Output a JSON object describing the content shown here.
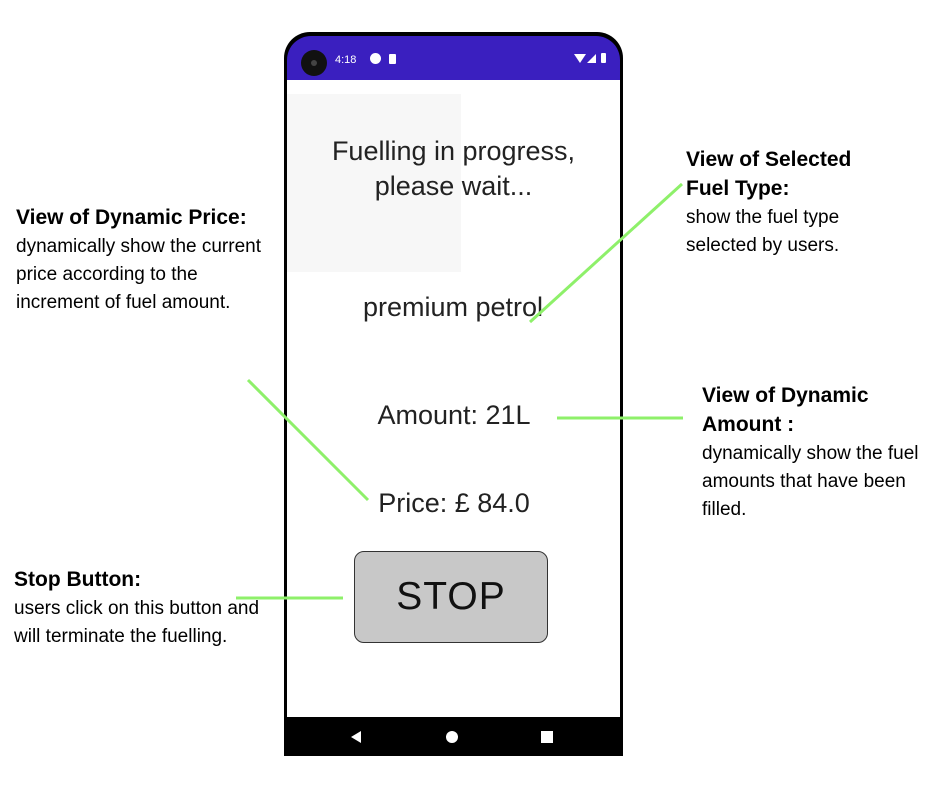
{
  "status_bar": {
    "time": "4:18"
  },
  "screen": {
    "title": "Fuelling in progress, please wait...",
    "fuel_type": "premium petrol",
    "amount": "Amount: 21L",
    "price": "Price: £ 84.0",
    "stop_label": "STOP"
  },
  "annotations": {
    "price": {
      "heading": "View of Dynamic Price:",
      "body": "dynamically show the current price according to the increment of fuel amount."
    },
    "fuel_type": {
      "heading": "View of Selected Fuel Type:",
      "body": "show the fuel type selected by users."
    },
    "amount": {
      "heading": "View of Dynamic Amount :",
      "body": "dynamically show the fuel amounts that have been filled."
    },
    "stop": {
      "heading": "Stop Button:",
      "body": "users click on this button and will terminate the fuelling."
    }
  },
  "colors": {
    "status_bar": "#3a1fbf",
    "callout_line": "#8ef06a",
    "stop_button": "#c8c8c8"
  }
}
